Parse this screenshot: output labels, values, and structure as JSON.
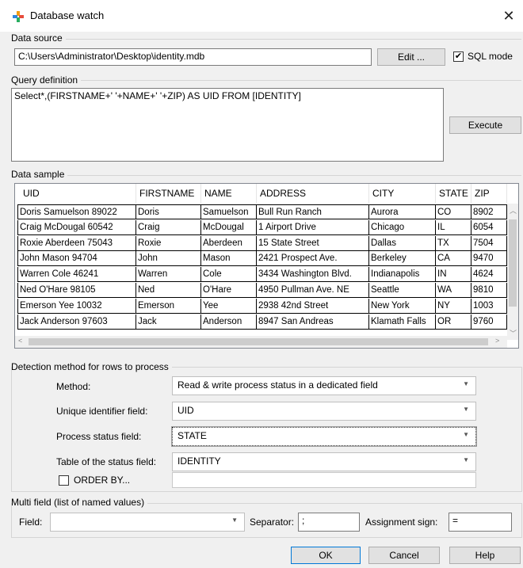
{
  "window": {
    "title": "Database watch",
    "close_glyph": "✕"
  },
  "data_source": {
    "section_label": "Data source",
    "path": "C:\\Users\\Administrator\\Desktop\\identity.mdb",
    "edit_label": "Edit ...",
    "sql_mode_label": "SQL mode",
    "sql_mode_checked": true
  },
  "query": {
    "section_label": "Query definition",
    "text": "Select*,(FIRSTNAME+' '+NAME+' '+ZIP) AS UID FROM [IDENTITY]",
    "execute_label": "Execute"
  },
  "data_sample": {
    "section_label": "Data sample",
    "columns": [
      "UID",
      "FIRSTNAME",
      "NAME",
      "ADDRESS",
      "CITY",
      "STATE",
      "ZIP"
    ],
    "rows": [
      [
        "Doris Samuelson 89022",
        "Doris",
        "Samuelson",
        "Bull Run Ranch",
        "Aurora",
        "CO",
        "8902"
      ],
      [
        "Craig McDougal 60542",
        "Craig",
        "McDougal",
        "1 Airport Drive",
        "Chicago",
        "IL",
        "6054"
      ],
      [
        "Roxie Aberdeen 75043",
        "Roxie",
        "Aberdeen",
        "15 State Street",
        "Dallas",
        "TX",
        "7504"
      ],
      [
        "John Mason 94704",
        "John",
        "Mason",
        "2421 Prospect Ave.",
        "Berkeley",
        "CA",
        "9470"
      ],
      [
        "Warren Cole 46241",
        "Warren",
        "Cole",
        "3434 Washington Blvd.",
        "Indianapolis",
        "IN",
        "4624"
      ],
      [
        "Ned O'Hare 98105",
        "Ned",
        "O'Hare",
        "4950 Pullman Ave. NE",
        "Seattle",
        "WA",
        "9810"
      ],
      [
        "Emerson Yee 10032",
        "Emerson",
        "Yee",
        "2938 42nd Street",
        "New York",
        "NY",
        "1003"
      ],
      [
        "Jack Anderson 97603",
        "Jack",
        "Anderson",
        "8947 San Andreas",
        "Klamath Falls",
        "OR",
        "9760"
      ]
    ]
  },
  "detection": {
    "section_label": "Detection method for rows to process",
    "method_label": "Method:",
    "method_value": "Read & write process status in a dedicated field",
    "uid_label": "Unique identifier field:",
    "uid_value": "UID",
    "status_label": "Process status field:",
    "status_value": "STATE",
    "table_label": "Table of the status field:",
    "table_value": "IDENTITY",
    "order_by_label": "ORDER BY...",
    "order_by_checked": false,
    "order_by_value": ""
  },
  "multi_field": {
    "section_label": "Multi field (list of named values)",
    "field_label": "Field:",
    "field_value": "",
    "separator_label": "Separator:",
    "separator_value": ";",
    "assignment_label": "Assignment sign:",
    "assignment_value": "="
  },
  "buttons": {
    "ok": "OK",
    "cancel": "Cancel",
    "help": "Help"
  },
  "colors": {
    "accent_orange": "#f39c12",
    "accent_blue": "#2e86de",
    "accent_red": "#e74c3c",
    "accent_green": "#27ae60"
  }
}
